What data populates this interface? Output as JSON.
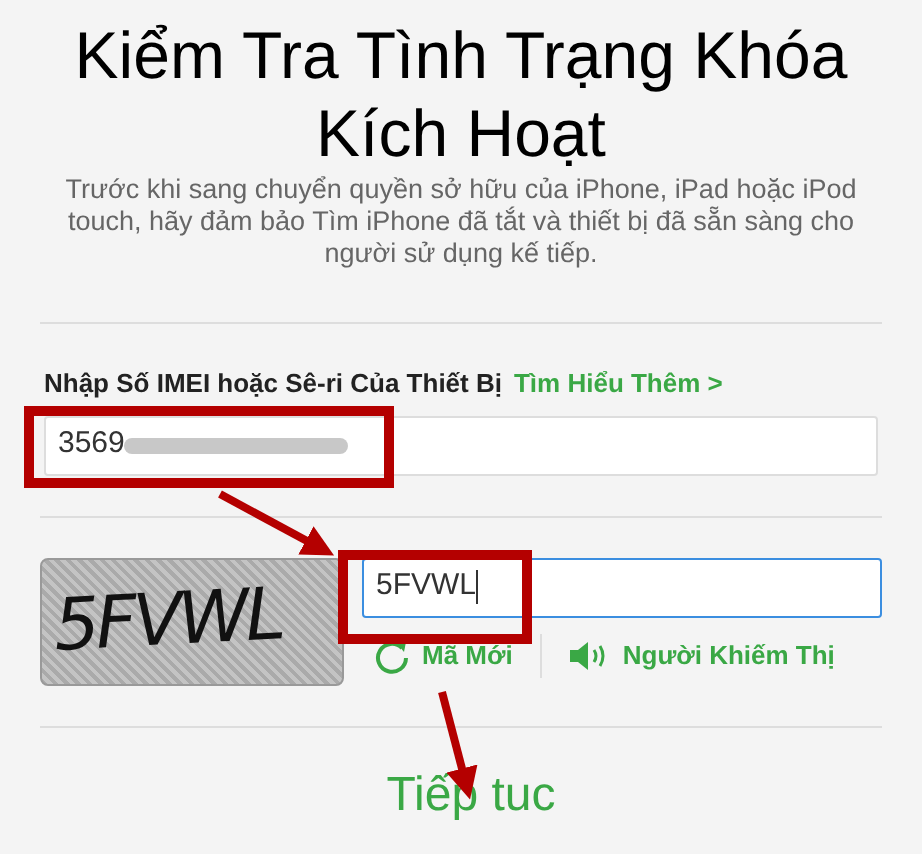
{
  "title": "Kiểm Tra Tình Trạng Khóa Kích Hoạt",
  "description": "Trước khi sang chuyển quyền sở hữu của iPhone, iPad hoặc iPod touch, hãy đảm bảo Tìm iPhone đã tắt và thiết bị đã sẵn sàng cho người sử dụng kế tiếp.",
  "imei": {
    "label": "Nhập Số IMEI hoặc Sê-ri Của Thiết Bị",
    "link": "Tìm Hiểu Thêm",
    "link_arrow": ">",
    "value": "3569"
  },
  "captcha": {
    "image_text": "5FVWL",
    "value": "5FVWL",
    "focused": true,
    "links": [
      {
        "kind": "refresh",
        "label": "Mã Mới"
      },
      {
        "kind": "audio",
        "label": "Người Khiếm Thị"
      }
    ]
  },
  "continue": "Tiếp tuc"
}
